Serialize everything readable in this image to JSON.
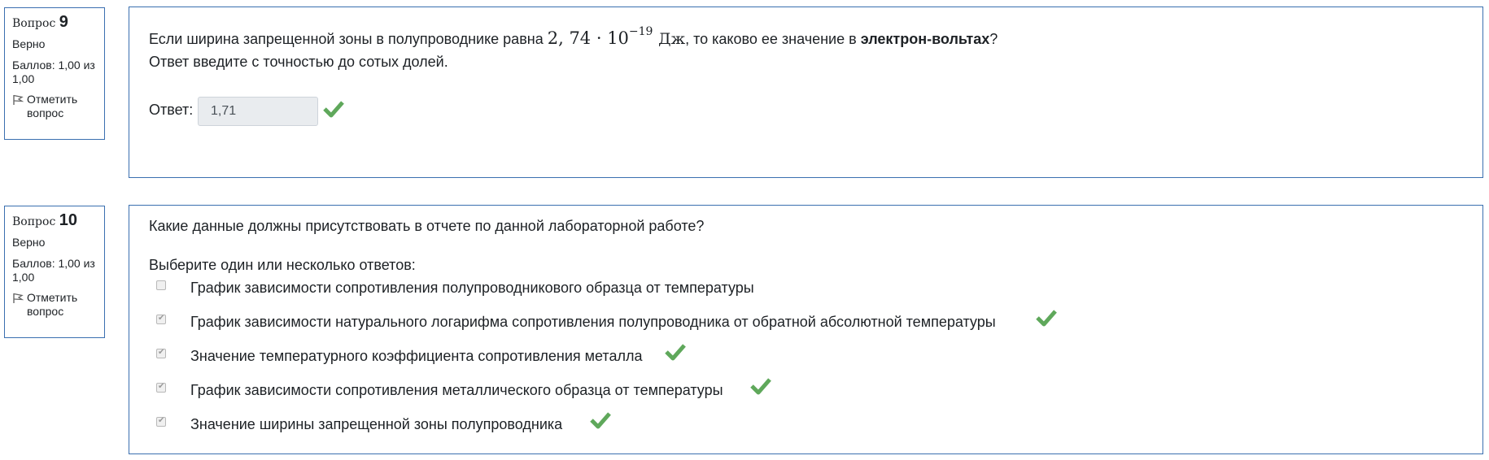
{
  "q9": {
    "label": "Вопрос",
    "number": "9",
    "state": "Верно",
    "grade": "Баллов: 1,00 из 1,00",
    "flag_label": "Отметить вопрос",
    "text_before": "Если ширина запрещенной зоны в полупроводнике равна",
    "math_base": "2, 74 · 10",
    "math_exp": "−19",
    "math_unit": "Дж",
    "text_mid": ", то каково ее значение в",
    "text_bold": "электрон-вольтах",
    "text_end": "?",
    "text_line2": "Ответ введите с точностью до сотых долей.",
    "answer_label": "Ответ:",
    "answer_value": "1,71",
    "correct": true
  },
  "q10": {
    "label": "Вопрос",
    "number": "10",
    "state": "Верно",
    "grade": "Баллов: 1,00 из 1,00",
    "flag_label": "Отметить вопрос",
    "text": "Какие данные должны присутствовать в отчете по данной лабораторной работе?",
    "prompt": "Выберите один или несколько ответов:",
    "options": [
      {
        "label": "График зависимости сопротивления полупроводникового образца от температуры",
        "checked": false,
        "correct": false
      },
      {
        "label": "График зависимости натурального логарифма сопротивления полупроводника от обратной абсолютной температуры",
        "checked": true,
        "correct": true
      },
      {
        "label": "Значение температурного коэффициента сопротивления металла",
        "checked": true,
        "correct": true
      },
      {
        "label": "График зависимости сопротивления металлического образца от температуры",
        "checked": true,
        "correct": true
      },
      {
        "label": "Значение ширины запрещенной зоны полупроводника",
        "checked": true,
        "correct": true
      }
    ]
  },
  "colors": {
    "border": "#3a6fb0",
    "check": "#5fa85b",
    "answer_bg": "#e9ecef"
  }
}
